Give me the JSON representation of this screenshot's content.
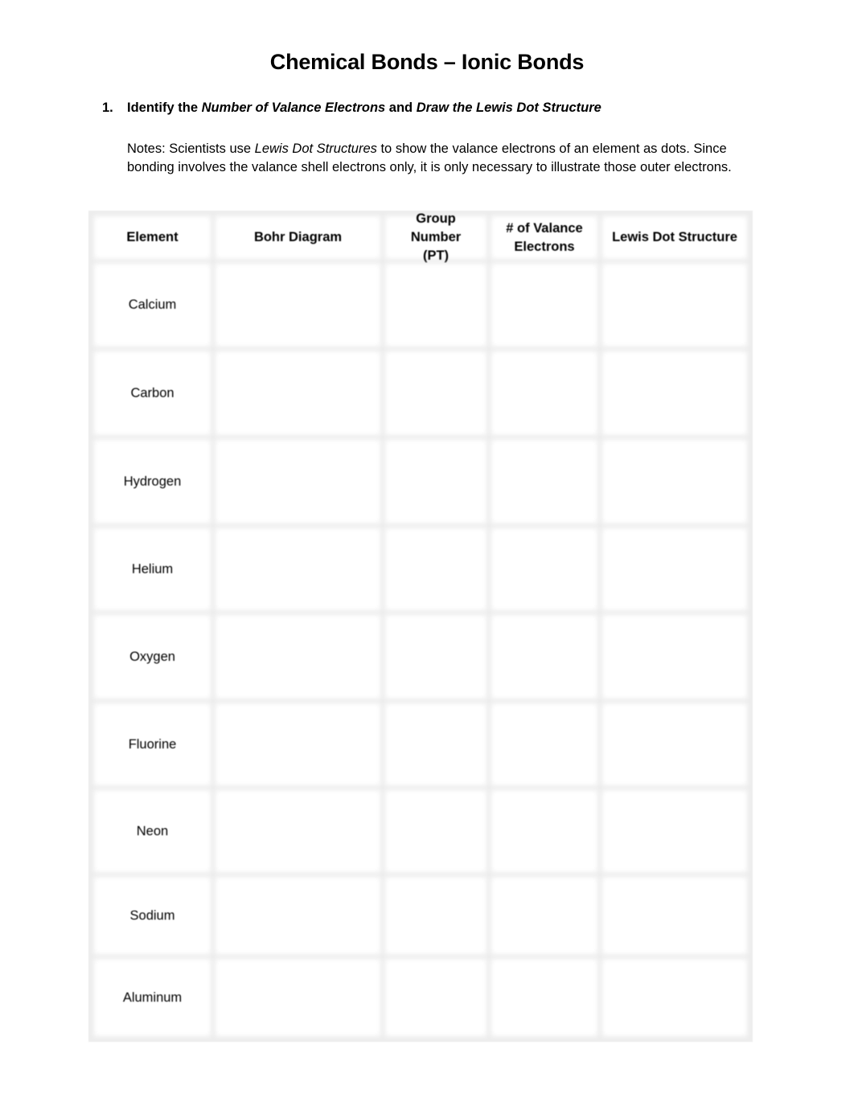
{
  "title": "Chemical Bonds – Ionic Bonds",
  "question": {
    "number": "1.",
    "prefix": "Identify the ",
    "em1": "Number of Valance Electrons",
    "mid": " and ",
    "em2": "Draw the Lewis Dot Structure"
  },
  "notes": {
    "prefix": "Notes: Scientists use ",
    "em": "Lewis Dot Structures",
    "suffix": " to show the valance electrons of an element as dots. Since bonding involves the valance shell electrons only, it is only necessary to illustrate those outer electrons."
  },
  "table": {
    "headers": [
      "Element",
      "Bohr Diagram",
      "Group Number (PT)",
      "# of Valance Electrons",
      "Lewis Dot Structure"
    ],
    "rows": [
      {
        "element": "Calcium"
      },
      {
        "element": "Carbon"
      },
      {
        "element": "Hydrogen"
      },
      {
        "element": "Helium"
      },
      {
        "element": "Oxygen"
      },
      {
        "element": "Fluorine"
      },
      {
        "element": "Neon"
      },
      {
        "element": "Sodium"
      },
      {
        "element": "Aluminum"
      }
    ]
  }
}
